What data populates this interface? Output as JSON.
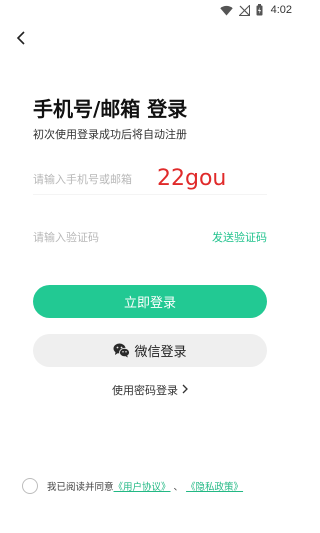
{
  "status_bar": {
    "time": "4:02",
    "icons": [
      "wifi-icon",
      "no-signal-icon",
      "battery-charging-icon"
    ]
  },
  "header": {
    "back_icon": "chevron-left-icon"
  },
  "title": "手机号/邮箱 登录",
  "subtitle": "初次使用登录成功后将自动注册",
  "account_input": {
    "placeholder": "请输入手机号或邮箱",
    "overlay_text": "22gou"
  },
  "code_input": {
    "placeholder": "请输入验证码",
    "send_label": "发送验证码"
  },
  "buttons": {
    "login_label": "立即登录",
    "wechat_label": "微信登录",
    "wechat_icon": "wechat-icon",
    "password_login_label": "使用密码登录"
  },
  "agreement": {
    "prefix": "我已阅读并同意",
    "user_agreement": "《用户协议》",
    "separator": "、",
    "privacy_policy": "《隐私政策》"
  },
  "colors": {
    "accent": "#22c993",
    "link": "#22b884",
    "overlay_red": "#e02a2a"
  }
}
